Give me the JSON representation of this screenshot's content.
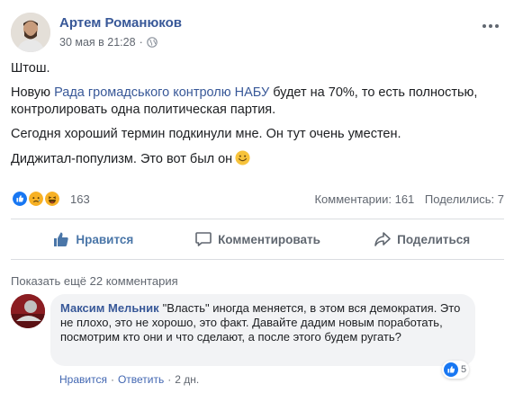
{
  "post": {
    "author": "Артем Романюков",
    "timestamp": "30 мая в 21:28",
    "privacy_icon": "globe-icon",
    "more_icon": "more-horizontal-icon",
    "paragraphs": {
      "p1": "Штош.",
      "p2_before": "Новую ",
      "p2_link": "Рада громадського контролю НАБУ",
      "p2_after": " будет на 70%, то есть полностью, контролировать одна политическая партия.",
      "p3": "Сегодня хороший термин подкинули мне. Он тут очень уместен.",
      "p4": "Диджитал-популизм. Это вот был он"
    },
    "emoji": "smile-emoji"
  },
  "reactions": {
    "icons": [
      "like-icon",
      "sad-icon",
      "haha-icon"
    ],
    "count": "163",
    "comments": "Комментарии: 161",
    "shares": "Поделились: 7"
  },
  "actions": {
    "like": "Нравится",
    "comment": "Комментировать",
    "share": "Поделиться"
  },
  "comments": {
    "show_more": "Показать ещё 22 комментария",
    "items": [
      {
        "author": "Максим Мельник",
        "text": "\"Власть\" иногда меняется, в этом вся демократия. Это не плохо, это не хорошо, это факт. Давайте дадим новым поработать, посмотрим кто они и что сделают, а после этого будем ругать?",
        "reaction_count": "5",
        "like": "Нравится",
        "reply": "Ответить",
        "time": "2 дн.",
        "sep": "·"
      }
    ]
  },
  "colors": {
    "link": "#385898",
    "like_blue": "#4a76a8",
    "muted": "#616770",
    "bubble_bg": "#f2f3f5"
  }
}
